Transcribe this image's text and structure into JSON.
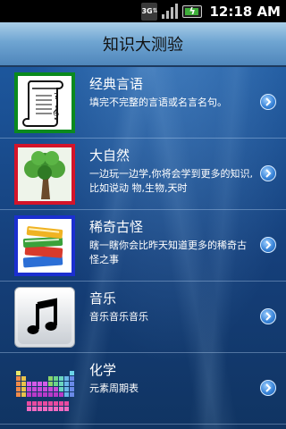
{
  "status_bar": {
    "network": "3G",
    "time": "12:18 AM"
  },
  "header": {
    "title": "知识大测验"
  },
  "categories": [
    {
      "title": "经典言语",
      "description": "填完不完整的言语或名言名句。",
      "icon": "scroll-music-icon",
      "frame_color": "#0a8a1e"
    },
    {
      "title": "大自然",
      "description": "一边玩一边学,你将会学到更多的知识,比如说动 物,生物,天时",
      "icon": "tree-icon",
      "frame_color": "#d4142a"
    },
    {
      "title": "稀奇古怪",
      "description": "瞎一瞎你会比昨天知道更多的稀奇古怪之事",
      "icon": "books-icon",
      "frame_color": "#1b2fd0"
    },
    {
      "title": "音乐",
      "description": "音乐音乐音乐",
      "icon": "music-note-icon",
      "frame_color": "#ffffff"
    },
    {
      "title": "化学",
      "description": "元素周期表",
      "icon": "periodic-table-icon",
      "frame_color": "#ffffff"
    }
  ],
  "colors": {
    "background": "#1a4f92",
    "title_bar": "#6fa5d2",
    "status_bar": "#000000",
    "go_button": "#3a85d9"
  }
}
